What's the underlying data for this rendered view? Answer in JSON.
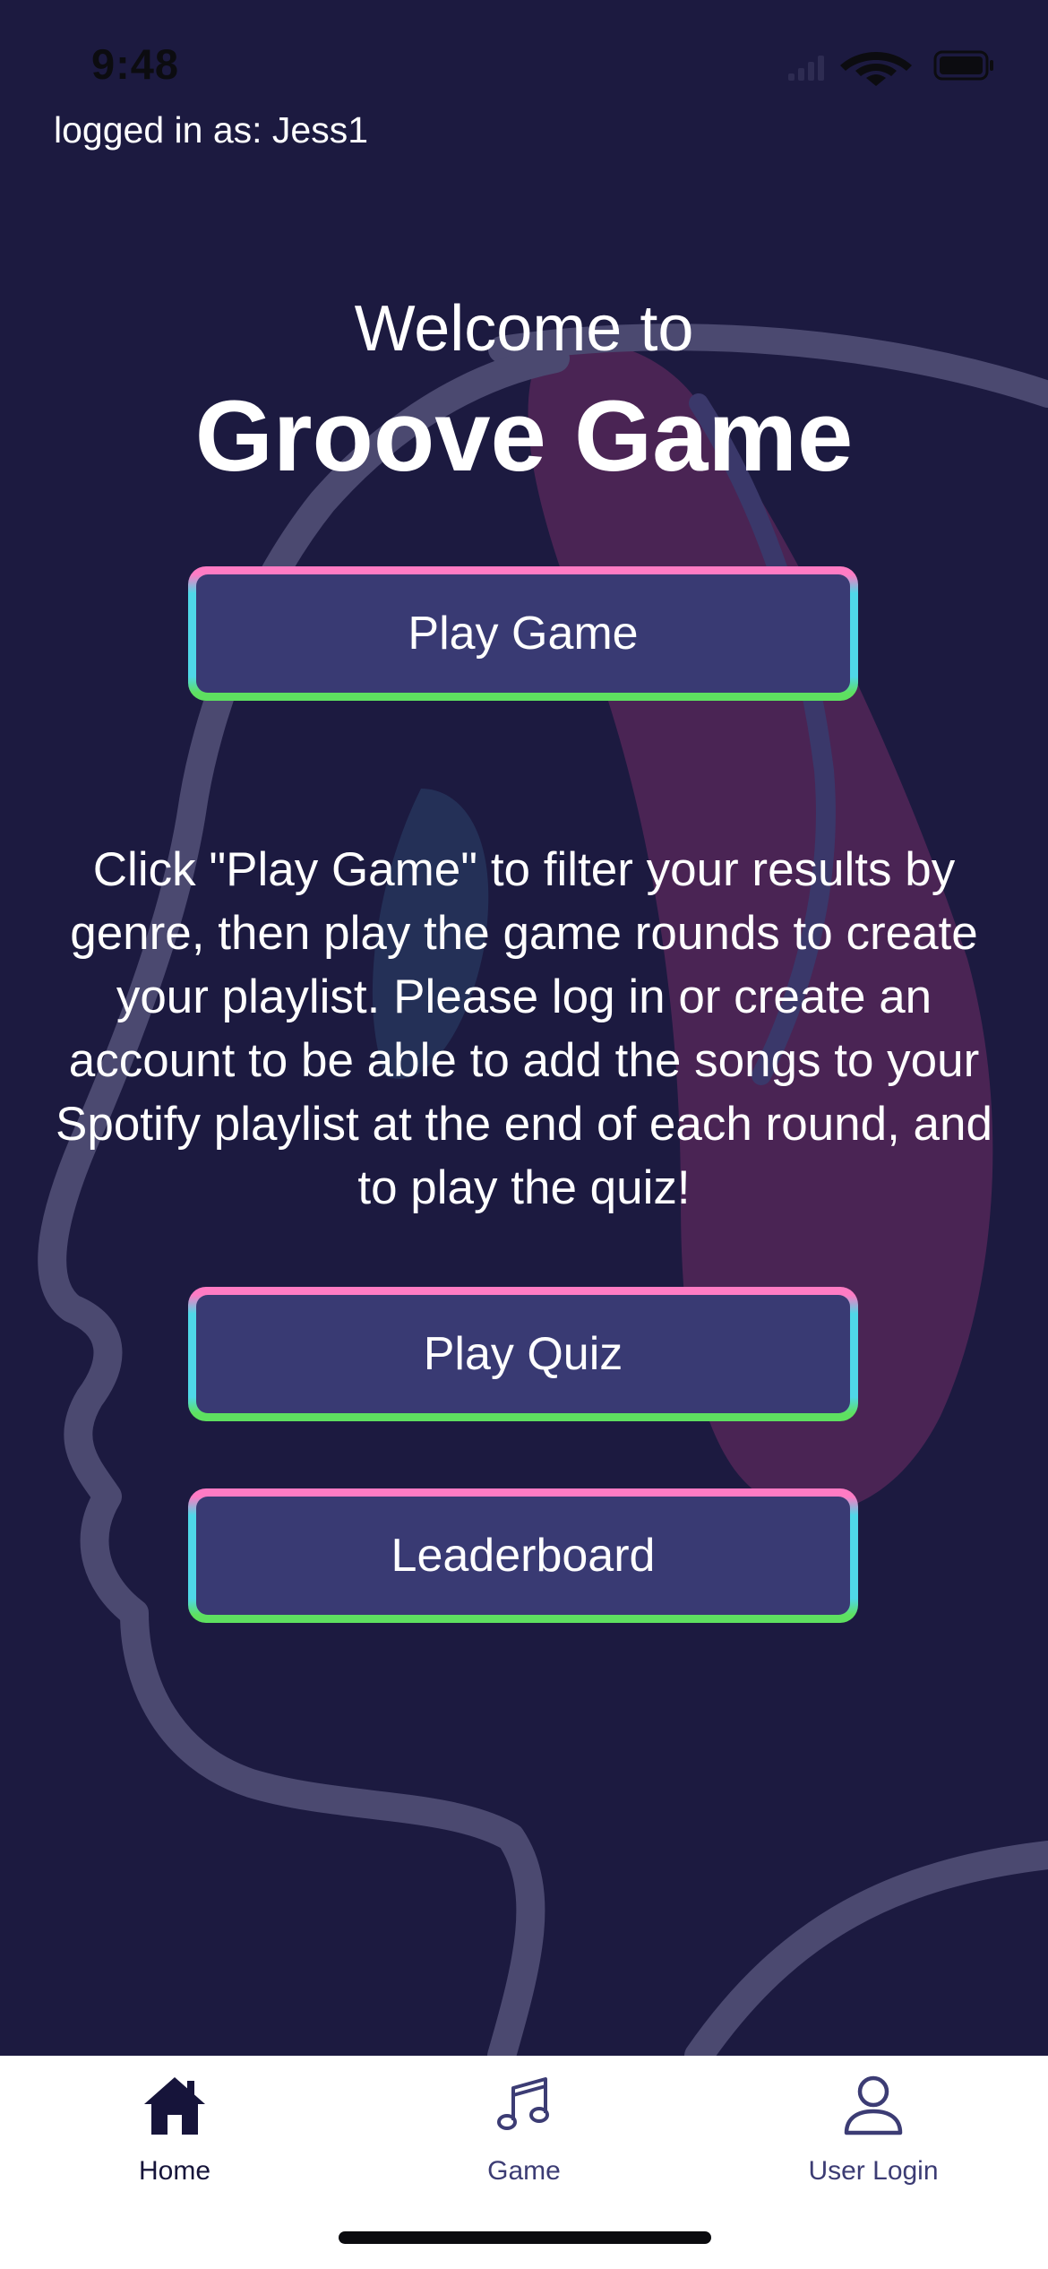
{
  "status_bar": {
    "time": "9:48"
  },
  "user": {
    "logged_in_text": "logged in as: Jess1"
  },
  "header": {
    "welcome": "Welcome to",
    "title": "Groove Game"
  },
  "buttons": {
    "play_game": "Play Game",
    "play_quiz": "Play Quiz",
    "leaderboard": "Leaderboard"
  },
  "description": "Click \"Play Game\" to filter your results by genre, then play the game rounds to create your playlist. Please log in or create an account to be able to add the songs to your Spotify playlist at the end of each round, and to play the quiz!",
  "tab_bar": {
    "selected": "home",
    "tabs": [
      {
        "id": "home",
        "label": "Home",
        "icon": "house-icon"
      },
      {
        "id": "game",
        "label": "Game",
        "icon": "music-note-icon"
      },
      {
        "id": "login",
        "label": "User Login",
        "icon": "user-icon"
      }
    ]
  },
  "colors": {
    "background": "#1c1a40",
    "button_fill": "#393a73",
    "border_pink": "#ff7bc4",
    "border_cyan": "#4fd7e8",
    "border_green": "#5ee060",
    "tab_active": "#16143a",
    "tab_inactive": "#3c3c74"
  }
}
